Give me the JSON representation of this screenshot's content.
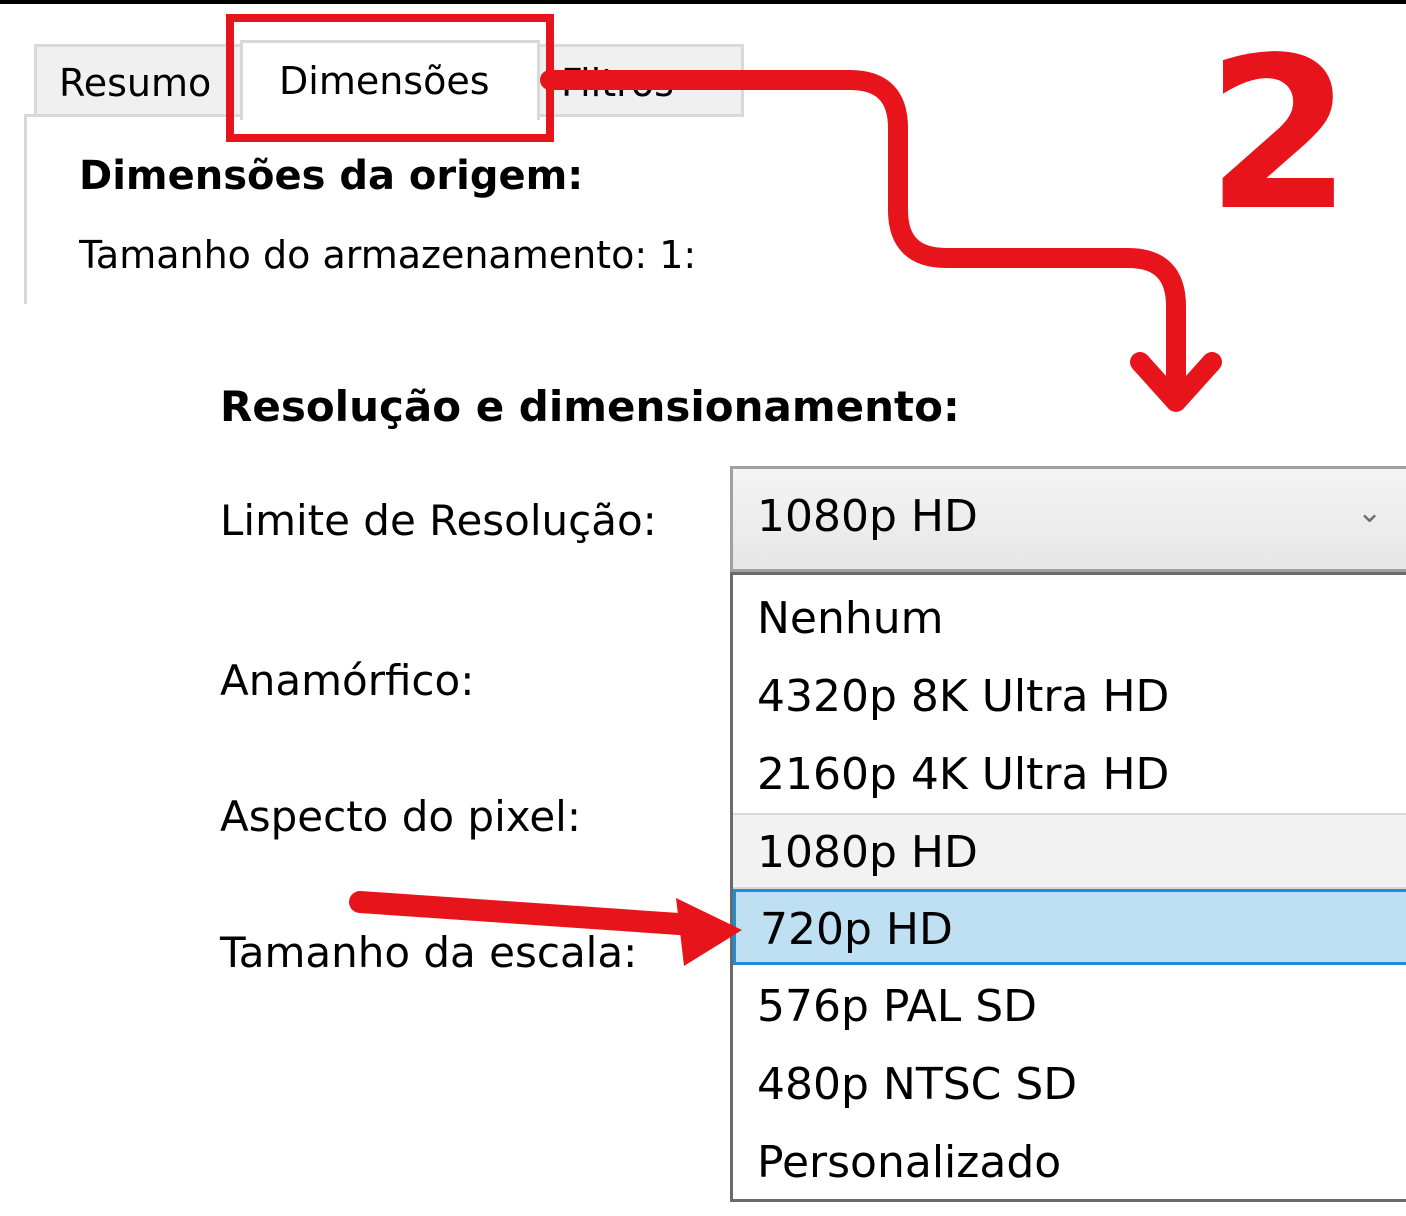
{
  "tabs": [
    {
      "label": "Resumo",
      "active": false
    },
    {
      "label": "Dimensões",
      "active": true
    },
    {
      "label": "Filtros",
      "active": false
    }
  ],
  "source": {
    "heading": "Dimensões da origem:",
    "storage_text": "Tamanho do armazenamento: 1:"
  },
  "annotation": {
    "step_number": "2",
    "color": "#e8141c"
  },
  "resolution": {
    "heading": "Resolução e dimensionamento:",
    "limit_label": "Limite de Resolução:",
    "anamorphic_label": "Anamórfico:",
    "pixel_aspect_label": "Aspecto do pixel:",
    "scale_size_label": "Tamanho da escala:",
    "selected_value": "1080p HD",
    "chevron_icon": "chevron-down-icon",
    "options": [
      "Nenhum",
      "4320p 8K Ultra HD",
      "2160p 4K Ultra HD",
      "1080p HD",
      "720p HD",
      "576p PAL SD",
      "480p NTSC SD",
      "Personalizado"
    ],
    "current_option": "1080p HD",
    "hovered_option": "720p HD",
    "hover_color": "#bfe0f3",
    "hover_border_color": "#1e8fd6"
  }
}
